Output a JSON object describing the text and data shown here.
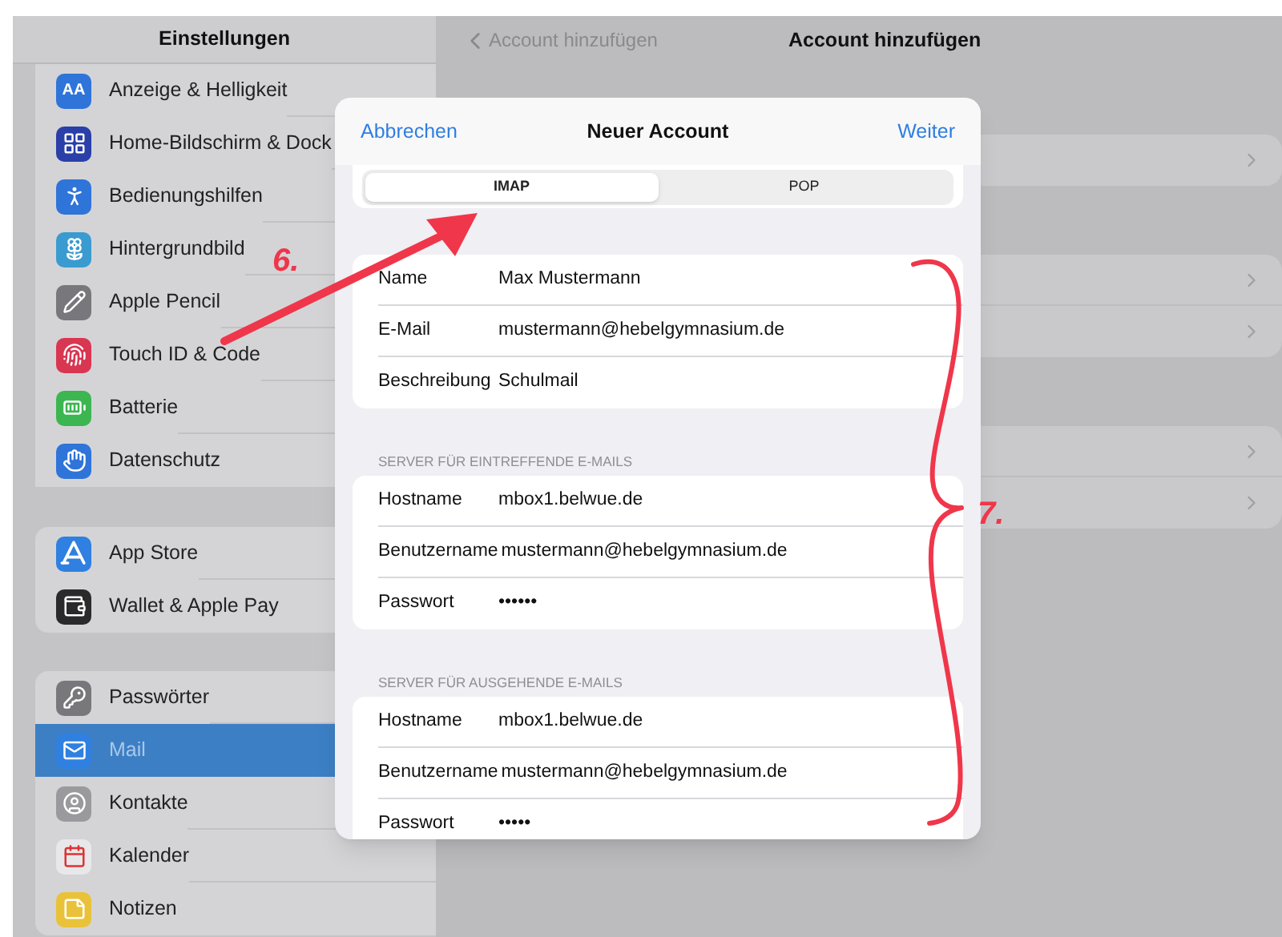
{
  "sidebar": {
    "title": "Einstellungen",
    "groups": [
      {
        "items": [
          {
            "label": "Anzeige & Helligkeit",
            "icon_text": "AA",
            "selected": false
          },
          {
            "label": "Home-Bildschirm & Dock",
            "selected": false
          },
          {
            "label": "Bedienungshilfen",
            "selected": false
          },
          {
            "label": "Hintergrundbild",
            "selected": false
          },
          {
            "label": "Apple Pencil",
            "selected": false
          },
          {
            "label": "Touch ID & Code",
            "selected": false
          },
          {
            "label": "Batterie",
            "selected": false
          },
          {
            "label": "Datenschutz",
            "selected": false
          }
        ]
      },
      {
        "items": [
          {
            "label": "App Store",
            "selected": false
          },
          {
            "label": "Wallet & Apple Pay",
            "selected": false
          }
        ]
      },
      {
        "items": [
          {
            "label": "Passwörter",
            "selected": false
          },
          {
            "label": "Mail",
            "selected": true
          },
          {
            "label": "Kontakte",
            "selected": false
          },
          {
            "label": "Kalender",
            "selected": false
          },
          {
            "label": "Notizen",
            "selected": false
          }
        ]
      }
    ]
  },
  "nav": {
    "back": "Account hinzufügen",
    "title": "Account hinzufügen"
  },
  "dialog": {
    "cancel": "Abbrechen",
    "title": "Neuer Account",
    "next": "Weiter",
    "segments": [
      {
        "label": "IMAP",
        "selected": true
      },
      {
        "label": "POP",
        "selected": false
      }
    ],
    "sections": [
      {
        "rows": [
          {
            "label": "Name",
            "value": "Max Mustermann"
          },
          {
            "label": "E-Mail",
            "value": "mustermann@hebelgymnasium.de"
          },
          {
            "label": "Beschreibung",
            "value": "Schulmail"
          }
        ]
      },
      {
        "header": "SERVER FÜR EINTREFFENDE E-MAILS",
        "rows": [
          {
            "label": "Hostname",
            "value": "mbox1.belwue.de"
          },
          {
            "label": "Benutzername",
            "value": "mustermann@hebelgymnasium.de"
          },
          {
            "label": "Passwort",
            "value": "••••••"
          }
        ]
      },
      {
        "header": "SERVER FÜR AUSGEHENDE E-MAILS",
        "rows": [
          {
            "label": "Hostname",
            "value": "mbox1.belwue.de"
          },
          {
            "label": "Benutzername",
            "value": "mustermann@hebelgymnasium.de"
          },
          {
            "label": "Passwort",
            "value": "•••••"
          }
        ]
      }
    ]
  },
  "annotations": [
    {
      "kind": "arrow",
      "label": "6."
    },
    {
      "kind": "brace",
      "label": "7."
    }
  ]
}
